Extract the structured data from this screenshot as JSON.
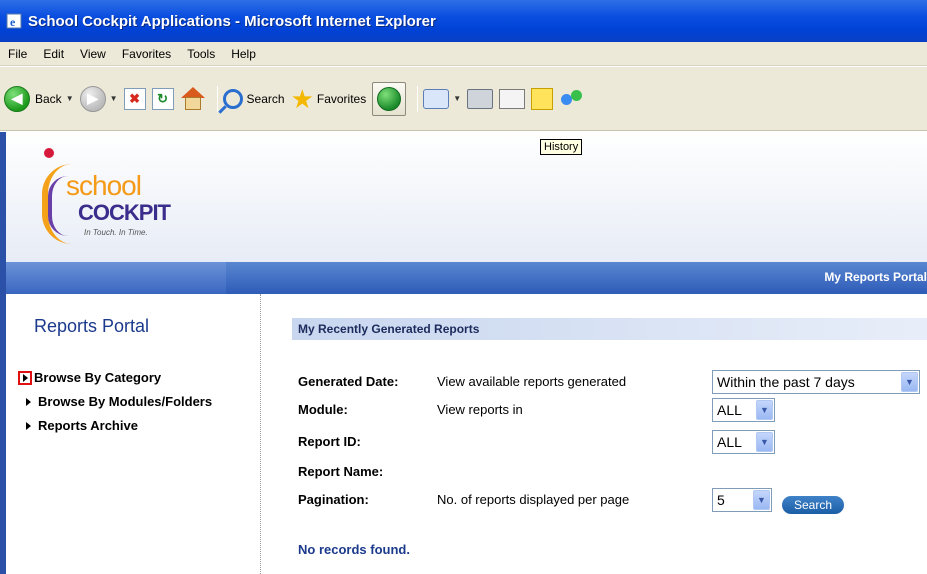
{
  "window": {
    "title": "School Cockpit Applications - Microsoft Internet Explorer"
  },
  "menu": [
    "File",
    "Edit",
    "View",
    "Favorites",
    "Tools",
    "Help"
  ],
  "toolbar": {
    "back_label": "Back",
    "search_label": "Search",
    "favorites_label": "Favorites",
    "tooltip": "History"
  },
  "logo": {
    "school": "school",
    "cockpit": "COCKPIT",
    "tagline": "In Touch. In Time."
  },
  "navbar": {
    "title": "My Reports Portal"
  },
  "sidebar": {
    "title": "Reports Portal",
    "items": [
      {
        "label": "Browse By Category",
        "active": true
      },
      {
        "label": "Browse By Modules/Folders",
        "active": false
      },
      {
        "label": "Reports Archive",
        "active": false
      }
    ]
  },
  "main": {
    "section_title": "My Recently Generated Reports",
    "fields": [
      {
        "label": "Generated Date:",
        "description": "View available reports generated",
        "value": "Within the past 7 days"
      },
      {
        "label": "Module:",
        "description": "View reports in",
        "value": "ALL"
      },
      {
        "label": "Report ID:",
        "description": "",
        "value": "ALL"
      },
      {
        "label": "Report Name:",
        "description": "",
        "value": ""
      },
      {
        "label": "Pagination:",
        "description": "No. of reports displayed per page",
        "value": "5"
      }
    ],
    "search_button": "Search",
    "no_records": "No records found."
  }
}
